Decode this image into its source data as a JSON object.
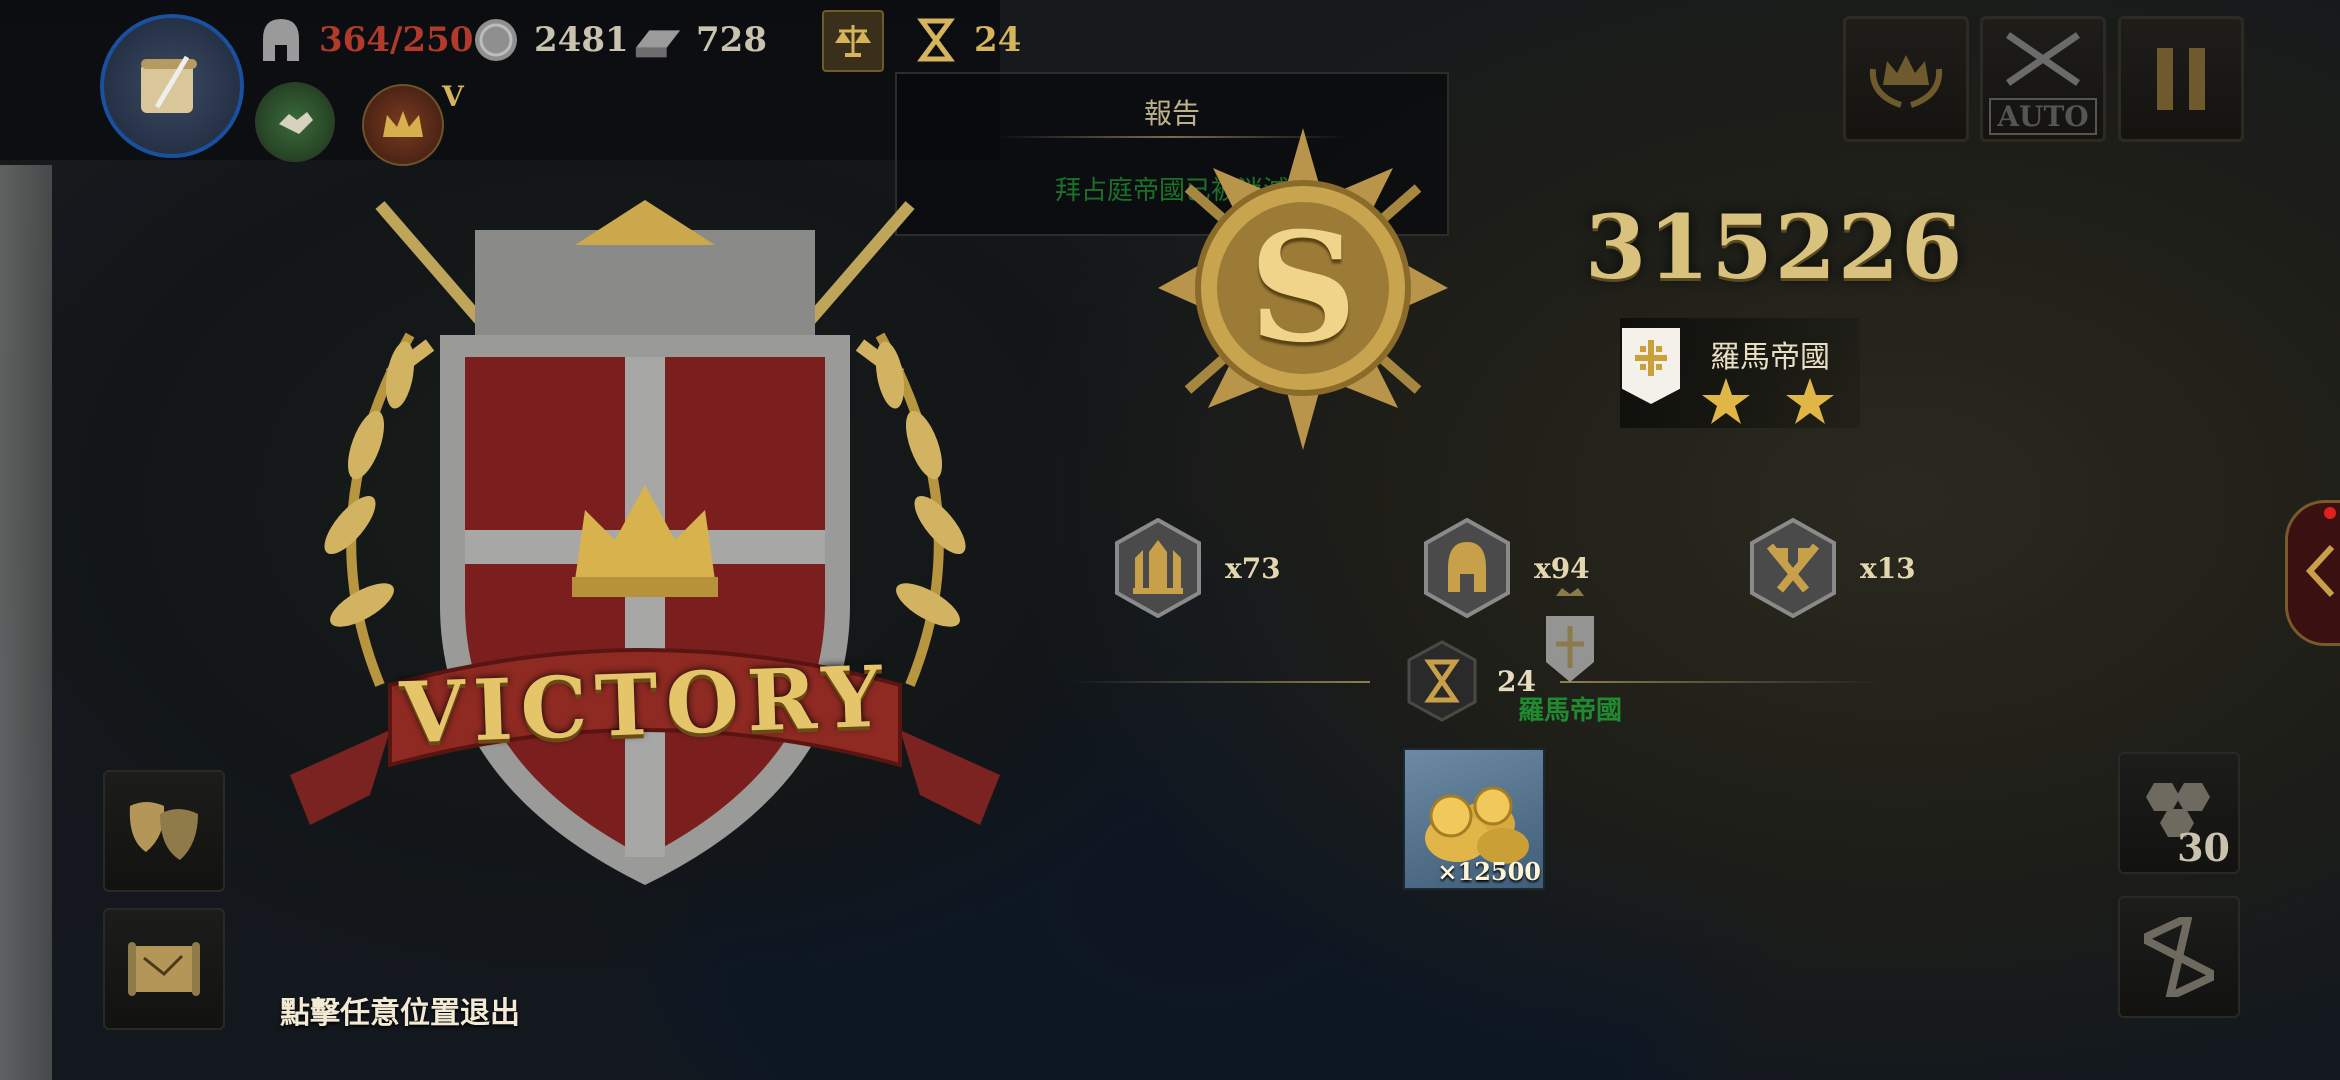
{
  "top_bar": {
    "troops": "364/250",
    "silver": "2481",
    "iron": "728",
    "turns": "24",
    "rank_badge": "V"
  },
  "report": {
    "title": "報告",
    "subtitle": "拜占庭帝國已被消滅"
  },
  "result": {
    "banner": "VICTORY",
    "rank_letter": "S",
    "score": "315226",
    "empire_name": "羅馬帝國",
    "stars": 2
  },
  "stats": [
    {
      "icon": "castle-icon",
      "value": "x73"
    },
    {
      "icon": "helmet-icon",
      "value": "x94"
    },
    {
      "icon": "crossed-flags-icon",
      "value": "x13"
    }
  ],
  "turns_used": "24",
  "map_label": "羅馬帝國",
  "reward": {
    "icon": "gold-coins-icon",
    "quantity": "×12500"
  },
  "exit_hint": "點擊任意位置退出",
  "side_buttons": {
    "hex_count": "30",
    "auto_label": "AUTO"
  },
  "colors": {
    "gold": "#d8c27e",
    "troops_red": "#b23a2a",
    "map_label_green": "#1f8a2f"
  }
}
